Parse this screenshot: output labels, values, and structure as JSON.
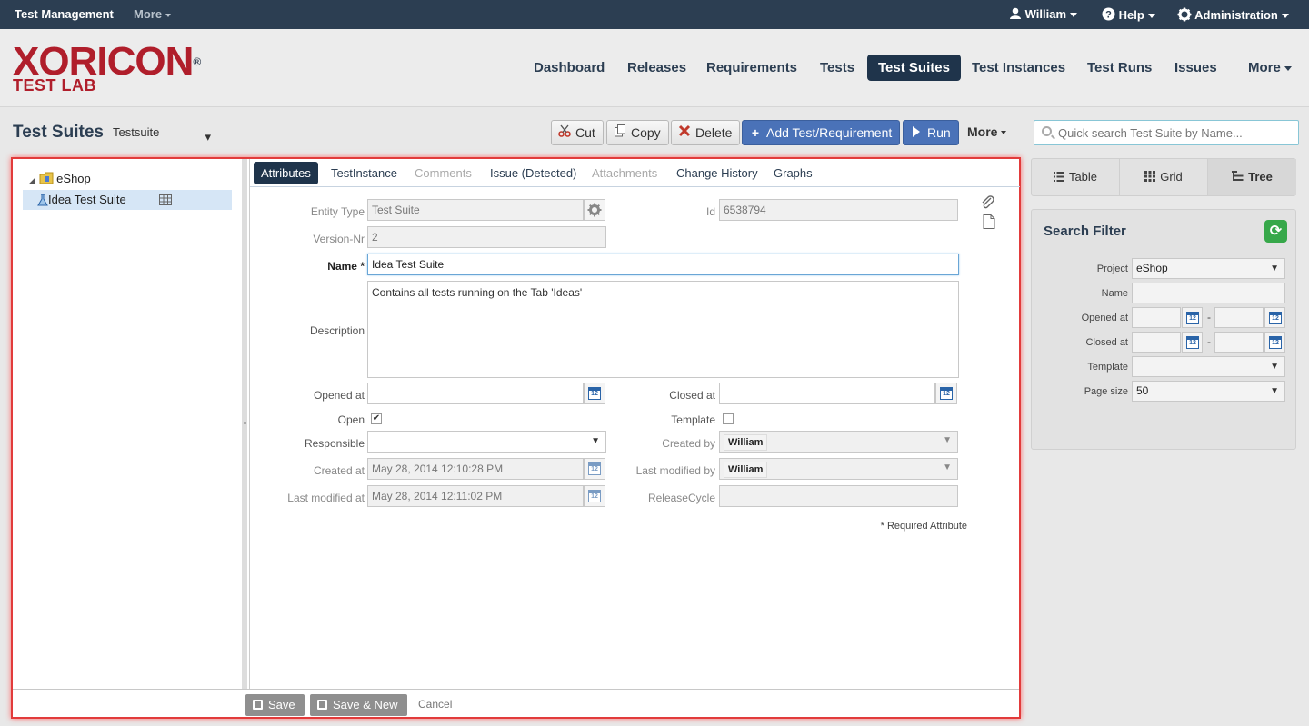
{
  "topbar": {
    "app_title": "Test Management",
    "more_label": "More",
    "user": "William",
    "help": "Help",
    "admin": "Administration"
  },
  "logo": {
    "main": "XORICON",
    "reg": "®",
    "sub": "TEST LAB"
  },
  "nav": {
    "items": [
      "Dashboard",
      "Releases",
      "Requirements",
      "Tests",
      "Test Suites",
      "Test Instances",
      "Test Runs",
      "Issues",
      "More"
    ],
    "active": "Test Suites"
  },
  "toolbar": {
    "page_title": "Test Suites",
    "type_select": "Testsuite",
    "cut": "Cut",
    "copy": "Copy",
    "delete": "Delete",
    "add": "Add Test/Requirement",
    "run": "Run",
    "more": "More",
    "search_placeholder": "Quick search Test Suite by Name..."
  },
  "tree": {
    "root": "eShop",
    "child": "Idea Test Suite"
  },
  "tabs": [
    "Attributes",
    "TestInstance",
    "Comments",
    "Issue (Detected)",
    "Attachments",
    "Change History",
    "Graphs"
  ],
  "form": {
    "entity_type_label": "Entity Type",
    "entity_type_value": "Test Suite",
    "id_label": "Id",
    "id_value": "6538794",
    "version_label": "Version-Nr",
    "version_value": "2",
    "name_label": "Name",
    "required_marker": "*",
    "name_value": "Idea Test Suite",
    "description_label": "Description",
    "description_value": "Contains all tests running on the Tab 'Ideas'",
    "opened_label": "Opened at",
    "opened_value": "",
    "closed_label": "Closed at",
    "closed_value": "",
    "open_label": "Open",
    "open_checked": true,
    "template_label": "Template",
    "template_checked": false,
    "responsible_label": "Responsible",
    "responsible_value": "",
    "created_by_label": "Created by",
    "created_by_value": "William",
    "created_at_label": "Created at",
    "created_at_value": "May 28, 2014 12:10:28 PM",
    "last_mod_by_label": "Last modified by",
    "last_mod_by_value": "William",
    "last_mod_at_label": "Last modified at",
    "last_mod_at_value": "May 28, 2014 12:11:02 PM",
    "release_cycle_label": "ReleaseCycle",
    "release_cycle_value": "",
    "required_note": "* Required Attribute",
    "calendar_day": "12"
  },
  "footer": {
    "save": "Save",
    "save_new": "Save & New",
    "cancel": "Cancel"
  },
  "views": {
    "table": "Table",
    "grid": "Grid",
    "tree": "Tree",
    "active": "Tree"
  },
  "filter": {
    "title": "Search Filter",
    "project_label": "Project",
    "project_value": "eShop",
    "name_label": "Name",
    "opened_label": "Opened at",
    "closed_label": "Closed at",
    "template_label": "Template",
    "page_size_label": "Page size",
    "page_size_value": "50",
    "range_sep": "-"
  },
  "colors": {
    "topbar": "#2c3e52",
    "nav_active": "#1f344b",
    "primary_button": "#4a72b8",
    "highlight_border": "#e23b3b",
    "refresh": "#37a84a",
    "logo_red": "#b01e2b"
  }
}
